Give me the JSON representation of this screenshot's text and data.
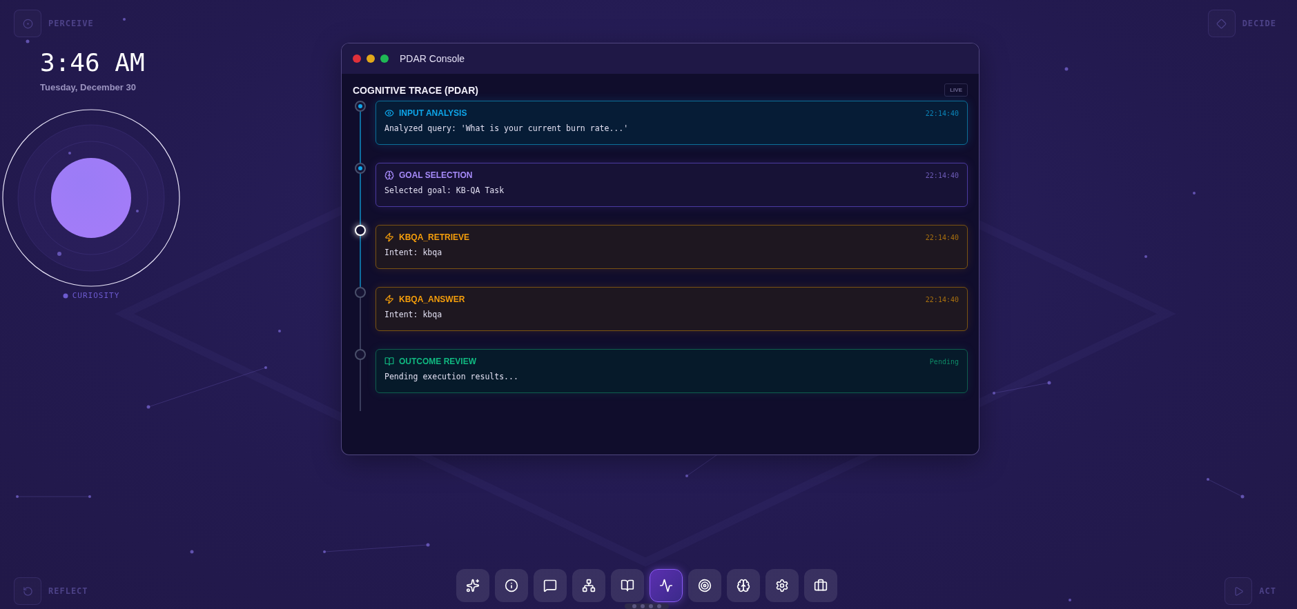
{
  "corners": [
    {
      "label": "PERCEIVE"
    },
    {
      "label": "DECIDE"
    },
    {
      "label": "REFLECT"
    },
    {
      "label": "ACT"
    }
  ],
  "clock": {
    "time": "3:46 AM",
    "date": "Tuesday, December 30"
  },
  "orb": {
    "label": "CURIOSITY"
  },
  "console": {
    "title": "PDAR Console",
    "heading": "COGNITIVE TRACE (PDAR)",
    "badge": "LIVE",
    "steps": [
      {
        "kind": "perceive",
        "done": true,
        "active": false,
        "title": "INPUT ANALYSIS",
        "time": "22:14:40",
        "text": "Analyzed query: 'What is your current burn rate...'"
      },
      {
        "kind": "goal",
        "done": true,
        "active": false,
        "title": "GOAL SELECTION",
        "time": "22:14:40",
        "text": "Selected goal: KB-QA Task"
      },
      {
        "kind": "action",
        "done": false,
        "active": true,
        "title": "KBQA_RETRIEVE",
        "time": "22:14:40",
        "text": "Intent: kbqa"
      },
      {
        "kind": "action",
        "done": false,
        "active": false,
        "title": "KBQA_ANSWER",
        "time": "22:14:40",
        "text": "Intent: kbqa"
      },
      {
        "kind": "review",
        "done": false,
        "active": false,
        "title": "OUTCOME REVIEW",
        "time": "Pending",
        "text": "Pending execution results..."
      }
    ]
  },
  "dock": [
    {
      "selected": false
    },
    {
      "selected": false
    },
    {
      "selected": false
    },
    {
      "selected": false
    },
    {
      "selected": false
    },
    {
      "selected": true
    },
    {
      "selected": false
    },
    {
      "selected": false
    },
    {
      "selected": false
    },
    {
      "selected": false
    }
  ]
}
